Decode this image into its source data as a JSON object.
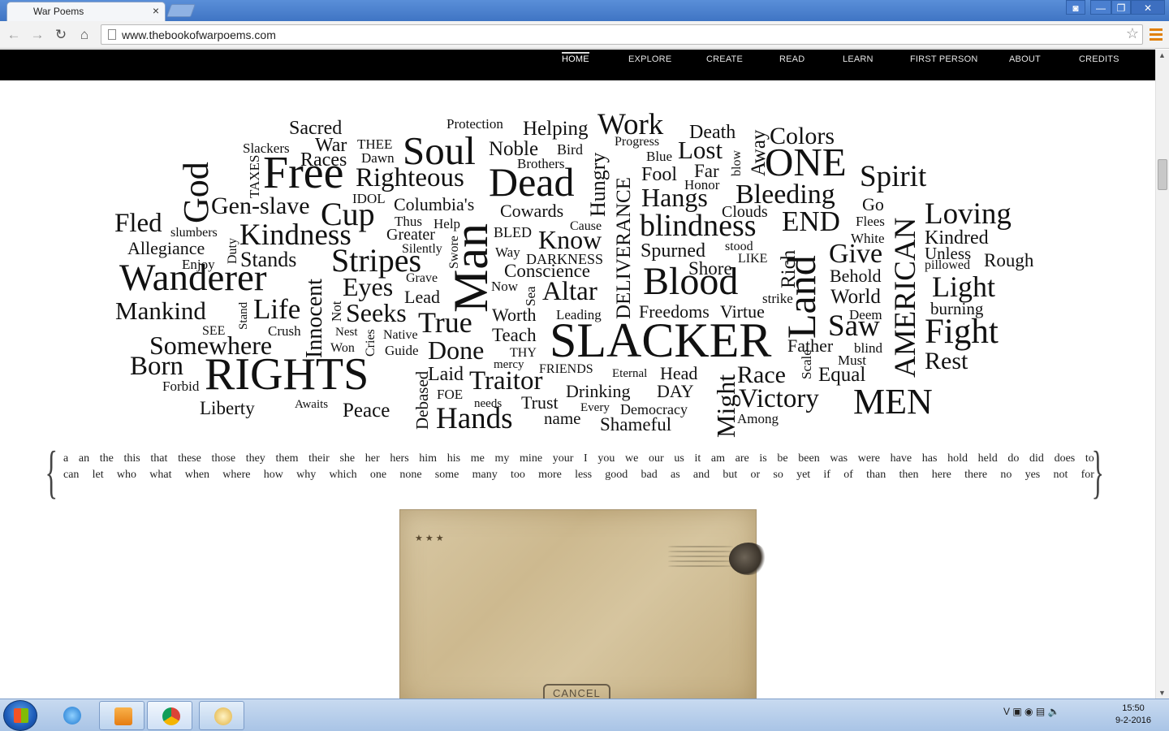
{
  "browser": {
    "tab_title": "War Poems",
    "tab_close": "×",
    "url": "www.thebookofwarpoems.com",
    "controls": {
      "back": "←",
      "forward": "→",
      "reload": "↻",
      "home": "⌂",
      "star": "☆"
    },
    "window_buttons": {
      "user": "◙",
      "minimize": "—",
      "maximize": "❐",
      "close": "✕"
    }
  },
  "site_nav": {
    "home": "HOME",
    "explore": "EXPLORE",
    "create": "CREATE",
    "read": "READ",
    "learn": "LEARN",
    "first_person": "FIRST PERSON",
    "about": "ABOUT",
    "credits": "CREDITS"
  },
  "word_cloud": [
    "Sacred",
    "Protection",
    "Helping",
    "Work",
    "Death",
    "Colors",
    "Slackers",
    "THEE",
    "War",
    "Progress",
    "Lost",
    "Away",
    "Races",
    "Dawn",
    "Soul",
    "Noble",
    "Bird",
    "Blue",
    "blow",
    "ONE",
    "God",
    "TAXES",
    "Free",
    "Brothers",
    "Far",
    "Righteous",
    "Dead",
    "Hungry",
    "Fool",
    "Spirit",
    "Honor",
    "IDOL",
    "Hangs",
    "Bleeding",
    "Gen-slave",
    "Columbia's",
    "DELIVERANCE",
    "Clouds",
    "Go",
    "Cup",
    "Cowards",
    "Fled",
    "Thus",
    "Help",
    "Cause",
    "END",
    "Flees",
    "Loving",
    "slumbers",
    "Greater",
    "BLED",
    "blindness",
    "White",
    "Kindred",
    "Duty",
    "Kindness",
    "Know",
    "Allegiance",
    "Silently",
    "Way",
    "Spurned",
    "stood",
    "Unless",
    "Stands",
    "Swore",
    "Enjoy",
    "DARKNESS",
    "Give",
    "pillowed",
    "Rough",
    "Stripes",
    "LIKE",
    "Rich",
    "Wanderer",
    "Grave",
    "Conscience",
    "Shore",
    "Behold",
    "Innocent",
    "Man",
    "Eyes",
    "Now",
    "Blood",
    "Light",
    "Sea",
    "Lead",
    "Altar",
    "strike",
    "World",
    "Mankind",
    "Life",
    "Stand",
    "Not",
    "Freedoms",
    "Virtue",
    "Deem",
    "burning",
    "Seeks",
    "Worth",
    "Leading",
    "Land",
    "AMERICAN",
    "SEE",
    "Crush",
    "True",
    "Saw",
    "Fight",
    "Nest",
    "Cries",
    "Native",
    "Teach",
    "SLACKER",
    "Somewhere",
    "Won",
    "Guide",
    "Done",
    "THY",
    "Father",
    "blind",
    "Must",
    "Born",
    "RIGHTS",
    "mercy",
    "FRIENDS",
    "Head",
    "Scale",
    "Rest",
    "Laid",
    "Eternal",
    "Race",
    "Equal",
    "Forbid",
    "Traitor",
    "Debased",
    "FOE",
    "Drinking",
    "DAY",
    "Might",
    "Awaits",
    "needs",
    "Trust",
    "Victory",
    "MEN",
    "Liberty",
    "Peace",
    "Every",
    "Democracy",
    "Hands",
    "name",
    "Among",
    "Shameful"
  ],
  "function_words": {
    "line1": [
      "a",
      "an",
      "the",
      "this",
      "that",
      "these",
      "those",
      "they",
      "them",
      "their",
      "she",
      "her",
      "hers",
      "him",
      "his",
      "me",
      "my",
      "mine",
      "your",
      "I",
      "you",
      "we",
      "our",
      "us",
      "it",
      "am",
      "are",
      "is",
      "be",
      "been",
      "was",
      "were",
      "have",
      "has",
      "hold",
      "held",
      "do",
      "did",
      "does",
      "to"
    ],
    "line2": [
      "can",
      "let",
      "who",
      "what",
      "when",
      "where",
      "how",
      "why",
      "which",
      "one",
      "none",
      "some",
      "many",
      "too",
      "more",
      "less",
      "good",
      "bad",
      "as",
      "and",
      "but",
      "or",
      "so",
      "yet",
      "if",
      "of",
      "than",
      "then",
      "here",
      "there",
      "no",
      "yes",
      "not",
      "for"
    ]
  },
  "envelope": {
    "stars": "★★★",
    "cancel_text": "CANCEL"
  },
  "taskbar": {
    "tray_icons": "V ▣ ◉ ▤ 🔈",
    "time": "15:50",
    "date": "9-2-2016"
  },
  "colors": {
    "titlebar": "#4a82d0",
    "nav_bg": "#000000",
    "menu_icon": "#e0800a",
    "ink": "#111111"
  }
}
